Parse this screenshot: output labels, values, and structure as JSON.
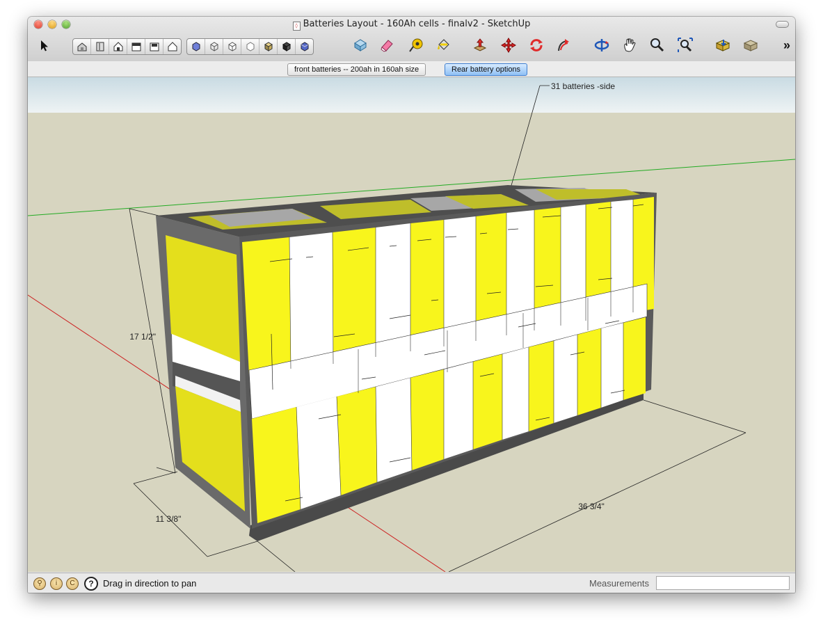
{
  "window": {
    "title": "Batteries Layout - 160Ah cells - finalv2 - SketchUp"
  },
  "toolbar": {
    "tools": [
      {
        "icon": "select-arrow-icon"
      },
      {
        "icon": "iso-view-icon"
      },
      {
        "icon": "top-view-icon"
      },
      {
        "icon": "front-view-icon"
      },
      {
        "icon": "right-view-icon"
      },
      {
        "icon": "back-view-icon"
      },
      {
        "icon": "left-view-icon"
      },
      {
        "icon": "xray-style-icon"
      },
      {
        "icon": "wireframe-style-icon"
      },
      {
        "icon": "hidden-line-style-icon"
      },
      {
        "icon": "shaded-style-icon"
      },
      {
        "icon": "shaded-textures-style-icon"
      },
      {
        "icon": "monochrome-style-icon"
      },
      {
        "icon": "xray-blue-style-icon"
      },
      {
        "icon": "make-component-icon"
      },
      {
        "icon": "eraser-icon"
      },
      {
        "icon": "tape-measure-icon"
      },
      {
        "icon": "paint-bucket-icon"
      },
      {
        "icon": "push-pull-icon"
      },
      {
        "icon": "move-icon"
      },
      {
        "icon": "rotate-icon"
      },
      {
        "icon": "follow-me-icon"
      },
      {
        "icon": "orbit-icon"
      },
      {
        "icon": "pan-hand-icon"
      },
      {
        "icon": "zoom-icon"
      },
      {
        "icon": "zoom-extents-icon"
      },
      {
        "icon": "get-models-icon"
      },
      {
        "icon": "share-model-icon"
      },
      {
        "icon": "overflow-chevron-icon"
      }
    ],
    "overflow_label": "»"
  },
  "scenes": [
    {
      "label": "front batteries -- 200ah in 160ah size",
      "active": false
    },
    {
      "label": "Rear battery options",
      "active": true
    }
  ],
  "model": {
    "annotation": "31 batteries -side",
    "dim_height": "17 1/2\"",
    "dim_depth": "11 3/8\"",
    "dim_length": "36 3/4\""
  },
  "status": {
    "message": "Drag in direction to pan",
    "measurements_label": "Measurements",
    "measurements_value": ""
  },
  "colors": {
    "cell_yellow": "#f8f51c",
    "cell_white": "#ffffff",
    "frame": "#5a5a5a",
    "ground": "#d7d5c0",
    "sky": "#dde9ee",
    "axis_red": "#cc2222",
    "axis_green": "#22aa22"
  }
}
